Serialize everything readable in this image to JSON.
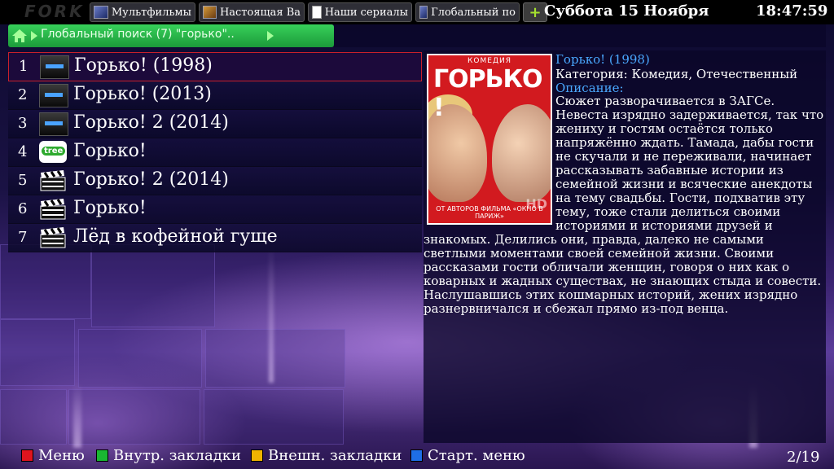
{
  "topbar": {
    "logo": "FORK",
    "tabs": [
      {
        "label": "Мультфильмы"
      },
      {
        "label": "Настоящая Ва"
      },
      {
        "label": "Наши сериалы"
      },
      {
        "label": "Глобальный по"
      }
    ],
    "add_label": "+",
    "date": "Суббота 15 Ноября",
    "time": "18:47:59"
  },
  "search": {
    "title": "Глобальный поиск (7) \"горько\".."
  },
  "results": [
    {
      "num": "1",
      "title": "Горько! (1998)",
      "thumb": "mt"
    },
    {
      "num": "2",
      "title": "Горько! (2013)",
      "thumb": "mt"
    },
    {
      "num": "3",
      "title": "Горько! 2 (2014)",
      "thumb": "mt"
    },
    {
      "num": "4",
      "title": "Горько!",
      "thumb": "tree"
    },
    {
      "num": "5",
      "title": "Горько! 2 (2014)",
      "thumb": "clapper"
    },
    {
      "num": "6",
      "title": "Горько!",
      "thumb": "clapper"
    },
    {
      "num": "7",
      "title": "Лёд в кофейной гуще",
      "thumb": "clapper"
    }
  ],
  "thumb_tree_label": "tree",
  "details": {
    "poster_top": "КОМЕДИЯ",
    "poster_title": "ГОРЬКО !",
    "poster_bottom": "ОТ АВТОРОВ ФИЛЬМА «ОКНО В ПАРИЖ»",
    "poster_hd": "HD",
    "title": "Горько! (1998)",
    "category": "Категория: Комедия, Отечественный",
    "description_label": "Описание:",
    "description": "Сюжет разворачивается в ЗАГСе. Невеста изрядно задерживается, так что жениху и гостям остаётся только напряжённо ждать. Тамада, дабы гости не скучали и не переживали, начинает рассказывать забавные истории из семейной жизни и всяческие анекдоты на тему свадьбы. Гости, подхватив эту тему, тоже стали делиться своими историями и историями друзей и знакомых. Делились они, правда, далеко не самыми светлыми моментами своей семейной жизни. Своими рассказами гости обличали женщин, говоря о них как о коварных и жадных существах, не знающих стыда и совести. Наслушавшись этих кошмарных историй, жених изрядно разнервничался и сбежал прямо из-под венца."
  },
  "bottom": {
    "buttons": [
      {
        "label": "Меню",
        "color": "#e0141e"
      },
      {
        "label": "Внутр. закладки",
        "color": "#19b832"
      },
      {
        "label": "Внешн. закладки",
        "color": "#f0b400"
      },
      {
        "label": "Старт. меню",
        "color": "#1e6ee6"
      }
    ],
    "pager": "2/19"
  },
  "colors": {
    "accent_blue": "#4aa8ff",
    "selection_border": "#c8202a",
    "search_bar_green": "#2fbf4f"
  }
}
